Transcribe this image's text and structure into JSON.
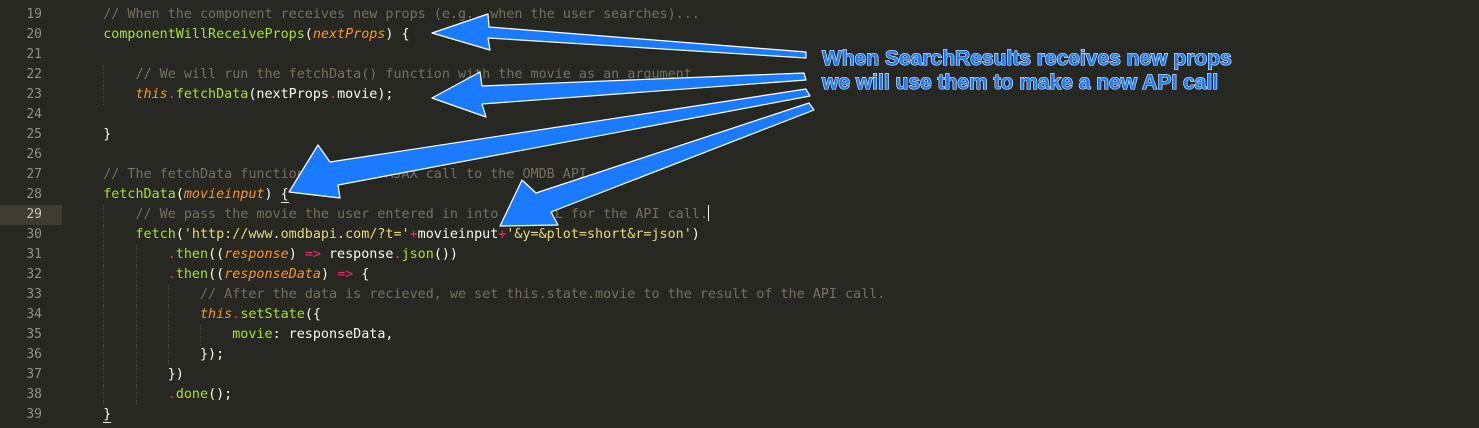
{
  "editor": {
    "current_line": 29,
    "colors": {
      "background": "#272822",
      "comment": "#75715e",
      "function": "#a6e22e",
      "parameter": "#fd971f",
      "keyword_operator": "#f92672",
      "string": "#e6db74",
      "property": "#66d9ef",
      "gutter_text": "#8f908a",
      "annotation_blue": "#1a7bff"
    },
    "lines": [
      {
        "n": "19",
        "indent": "    ",
        "tokens": [
          {
            "t": "// When the component receives new props (e.g., when the user searches)...",
            "c": "c-comment"
          }
        ]
      },
      {
        "n": "20",
        "indent": "    ",
        "tokens": [
          {
            "t": "componentWillReceiveProps",
            "c": "c-fn"
          },
          {
            "t": "(",
            "c": "c-punct"
          },
          {
            "t": "nextProps",
            "c": "c-param"
          },
          {
            "t": ") {",
            "c": "c-punct"
          }
        ]
      },
      {
        "n": "21",
        "indent": "",
        "tokens": []
      },
      {
        "n": "22",
        "indent": "        ",
        "tokens": [
          {
            "t": "// We will run the fetchData() function with the movie as an argument",
            "c": "c-comment"
          }
        ]
      },
      {
        "n": "23",
        "indent": "        ",
        "tokens": [
          {
            "t": "this",
            "c": "c-this"
          },
          {
            "t": ".",
            "c": "c-op"
          },
          {
            "t": "fetchData",
            "c": "c-fn"
          },
          {
            "t": "(nextProps",
            "c": "c-punct"
          },
          {
            "t": ".",
            "c": "c-op"
          },
          {
            "t": "movie);",
            "c": "c-punct"
          }
        ]
      },
      {
        "n": "24",
        "indent": "",
        "tokens": []
      },
      {
        "n": "25",
        "indent": "    ",
        "tokens": [
          {
            "t": "}",
            "c": "c-punct"
          }
        ]
      },
      {
        "n": "26",
        "indent": "",
        "tokens": []
      },
      {
        "n": "27",
        "indent": "    ",
        "tokens": [
          {
            "t": "// The fetchData function makes an AJAX call to the OMDB API.",
            "c": "c-comment"
          }
        ]
      },
      {
        "n": "28",
        "indent": "    ",
        "tokens": [
          {
            "t": "fetchData",
            "c": "c-fn"
          },
          {
            "t": "(",
            "c": "c-punct"
          },
          {
            "t": "movieinput",
            "c": "c-param"
          },
          {
            "t": ") ",
            "c": "c-punct"
          },
          {
            "t": "{",
            "c": "c-punct bracket-u"
          }
        ]
      },
      {
        "n": "29",
        "indent": "        ",
        "cursor": true,
        "tokens": [
          {
            "t": "// We pass the movie the user entered in into the URL for the API call.",
            "c": "c-comment"
          }
        ]
      },
      {
        "n": "30",
        "indent": "        ",
        "tokens": [
          {
            "t": "fetch",
            "c": "c-fn"
          },
          {
            "t": "(",
            "c": "c-punct"
          },
          {
            "t": "'http://www.omdbapi.com/?t='",
            "c": "c-str"
          },
          {
            "t": "+",
            "c": "c-op"
          },
          {
            "t": "movieinput",
            "c": "c-punct"
          },
          {
            "t": "+",
            "c": "c-op"
          },
          {
            "t": "'&y=&plot=short&r=json'",
            "c": "c-str"
          },
          {
            "t": ")",
            "c": "c-punct"
          }
        ]
      },
      {
        "n": "31",
        "indent": "            ",
        "tokens": [
          {
            "t": ".",
            "c": "c-op"
          },
          {
            "t": "then",
            "c": "c-fn"
          },
          {
            "t": "((",
            "c": "c-punct"
          },
          {
            "t": "response",
            "c": "c-param"
          },
          {
            "t": ") ",
            "c": "c-punct"
          },
          {
            "t": "=>",
            "c": "c-op"
          },
          {
            "t": " response",
            "c": "c-punct"
          },
          {
            "t": ".",
            "c": "c-op"
          },
          {
            "t": "json",
            "c": "c-fn"
          },
          {
            "t": "())",
            "c": "c-punct"
          }
        ]
      },
      {
        "n": "32",
        "indent": "            ",
        "tokens": [
          {
            "t": ".",
            "c": "c-op"
          },
          {
            "t": "then",
            "c": "c-fn"
          },
          {
            "t": "((",
            "c": "c-punct"
          },
          {
            "t": "responseData",
            "c": "c-param"
          },
          {
            "t": ") ",
            "c": "c-punct"
          },
          {
            "t": "=>",
            "c": "c-op"
          },
          {
            "t": " {",
            "c": "c-punct"
          }
        ]
      },
      {
        "n": "33",
        "indent": "                ",
        "tokens": [
          {
            "t": "// After the data is recieved, we set this.state.movie to the result of the API call.",
            "c": "c-comment"
          }
        ]
      },
      {
        "n": "34",
        "indent": "                ",
        "tokens": [
          {
            "t": "this",
            "c": "c-this"
          },
          {
            "t": ".",
            "c": "c-op"
          },
          {
            "t": "setState",
            "c": "c-fn"
          },
          {
            "t": "({",
            "c": "c-punct"
          }
        ]
      },
      {
        "n": "35",
        "indent": "                    ",
        "tokens": [
          {
            "t": "movie",
            "c": "c-fn"
          },
          {
            "t": ": responseData,",
            "c": "c-punct"
          }
        ]
      },
      {
        "n": "36",
        "indent": "                ",
        "tokens": [
          {
            "t": "});",
            "c": "c-punct"
          }
        ]
      },
      {
        "n": "37",
        "indent": "            ",
        "tokens": [
          {
            "t": "})",
            "c": "c-punct"
          }
        ]
      },
      {
        "n": "38",
        "indent": "            ",
        "tokens": [
          {
            "t": ".",
            "c": "c-op"
          },
          {
            "t": "done",
            "c": "c-fn"
          },
          {
            "t": "();",
            "c": "c-punct"
          }
        ]
      },
      {
        "n": "39",
        "indent": "    ",
        "tokens": [
          {
            "t": "}",
            "c": "c-punct bracket-u"
          }
        ]
      }
    ]
  },
  "annotation": {
    "line1": "When SearchResults receives new props",
    "line2": "we will use them to make a new API call"
  }
}
